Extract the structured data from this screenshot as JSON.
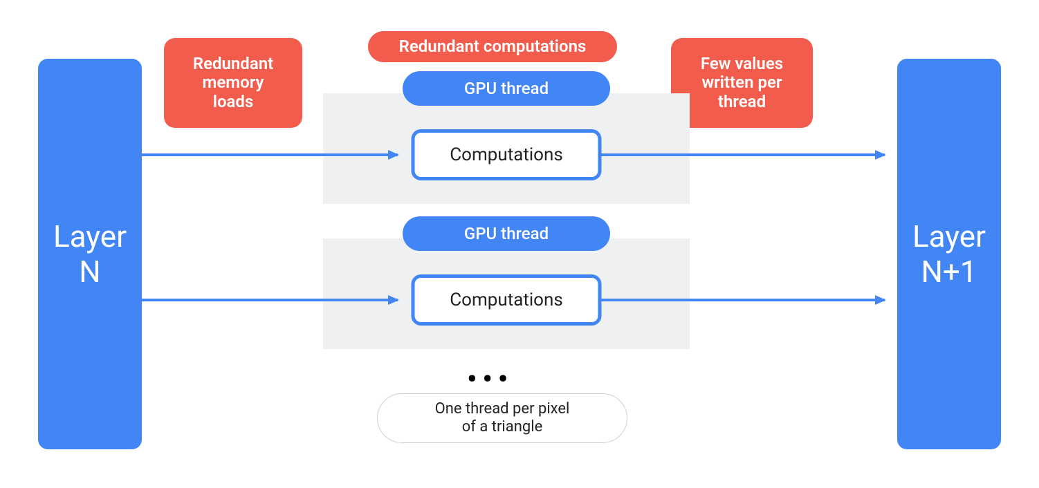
{
  "colors": {
    "blue": "#4285f4",
    "red": "#f25c4d",
    "gray": "#eef0f1"
  },
  "layers": {
    "left": "Layer\nN",
    "right": "Layer\nN+1"
  },
  "callouts": {
    "loads": "Redundant\nmemory\nloads",
    "comp": "Redundant computations",
    "write": "Few values\nwritten per\nthread"
  },
  "threads": {
    "pill": "GPU thread",
    "box": "Computations"
  },
  "ellipsis": "•••",
  "footer": "One thread per pixel\nof a triangle"
}
